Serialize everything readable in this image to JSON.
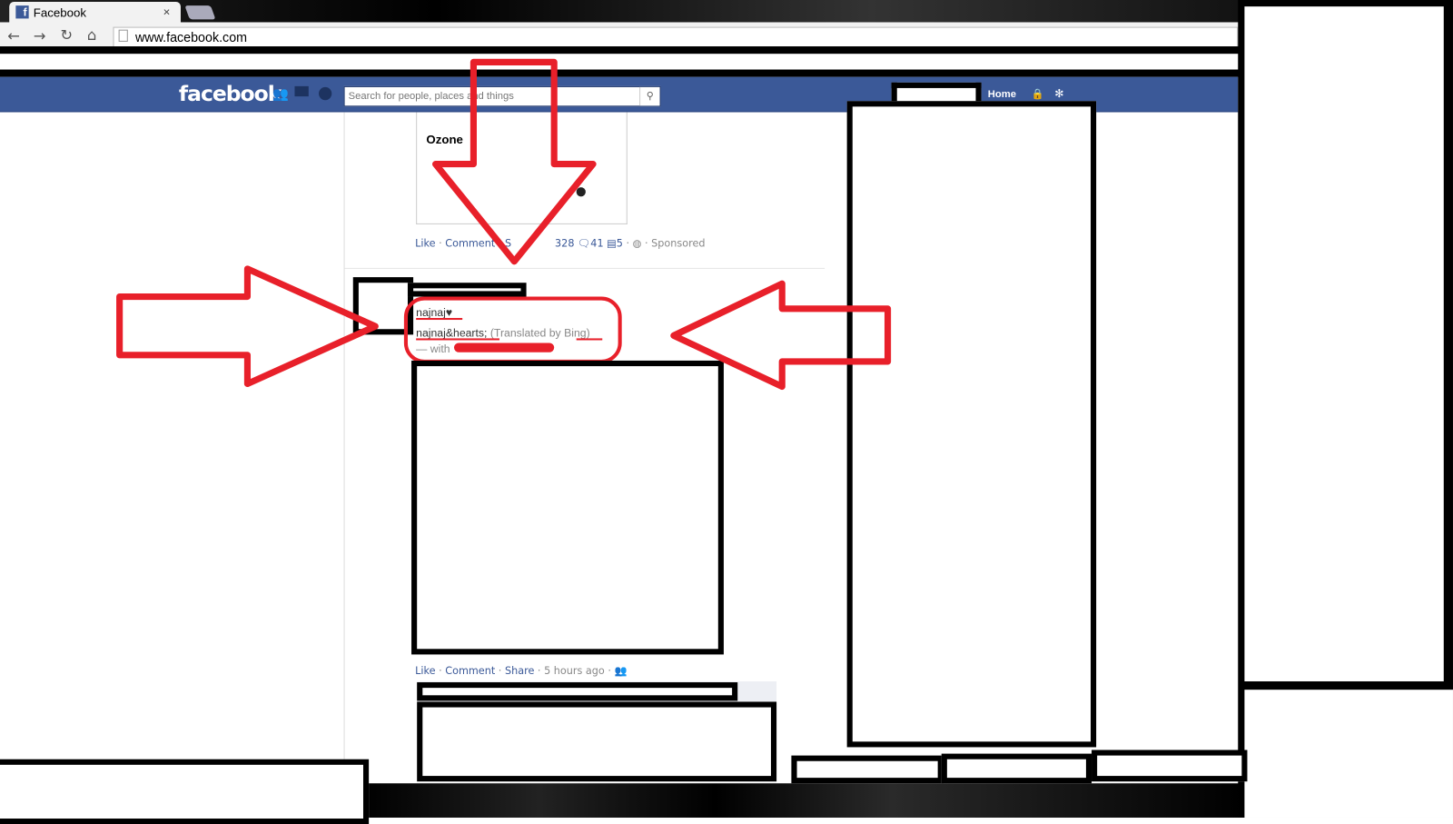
{
  "browser": {
    "tab_title": "Facebook",
    "tab_close": "×",
    "url": "www.facebook.com"
  },
  "facebook": {
    "logo": "facebook",
    "search_placeholder": "Search for people, places and things",
    "nav_home": "Home",
    "brand_color": "#3b5998"
  },
  "sponsored_post": {
    "title": "Ozone",
    "actions": {
      "like": "Like",
      "comment": "Comment",
      "share": "S"
    },
    "likes": "328",
    "comments": "41",
    "shares": "5",
    "sponsored": "Sponsored"
  },
  "post": {
    "status": "najnaj♥",
    "translation": "najnaj&hearts;",
    "translated_by": "(Translated by ",
    "bing": "Bing",
    "close_paren": ")",
    "with": "— with",
    "actions": {
      "like": "Like",
      "comment": "Comment",
      "share": "Share"
    },
    "time": "5 hours ago"
  },
  "annotation_color": "#e8202a"
}
